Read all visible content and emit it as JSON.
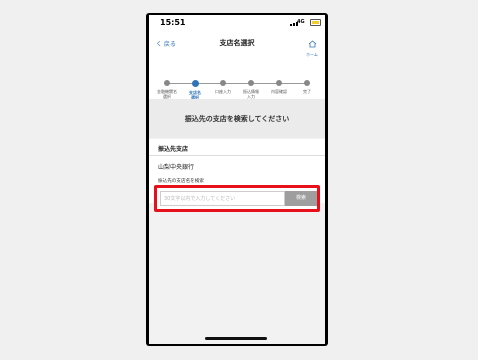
{
  "status_bar": {
    "time": "15:51",
    "network": "4G"
  },
  "nav": {
    "back": "く 戻る",
    "title": "支店名選択",
    "home": "ホーム"
  },
  "steps": [
    {
      "label": "金融機関名\n選択",
      "active": false
    },
    {
      "label": "支店名\n選択",
      "active": true
    },
    {
      "label": "口座入力",
      "active": false
    },
    {
      "label": "振込情報\n入力",
      "active": false
    },
    {
      "label": "内容確認",
      "active": false
    },
    {
      "label": "完了",
      "active": false
    }
  ],
  "banner": "振込先の支店を検索してください",
  "section": {
    "title": "振込先支店",
    "bank_name": "山梨中央銀行",
    "field_label": "振込先の支店名を検索"
  },
  "search": {
    "placeholder": "30文字以内で入力してください",
    "value": "",
    "button": "検索"
  },
  "colors": {
    "accent": "#2f73b8",
    "highlight": "#e8101a",
    "button": "#9e9e9e"
  }
}
